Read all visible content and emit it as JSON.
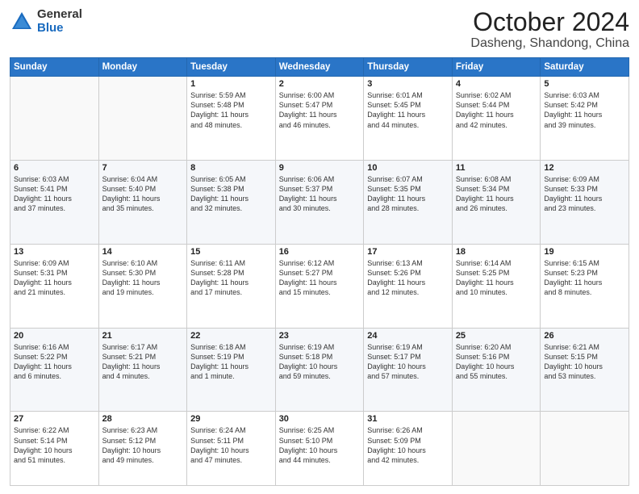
{
  "logo": {
    "general": "General",
    "blue": "Blue"
  },
  "header": {
    "month": "October 2024",
    "location": "Dasheng, Shandong, China"
  },
  "days_of_week": [
    "Sunday",
    "Monday",
    "Tuesday",
    "Wednesday",
    "Thursday",
    "Friday",
    "Saturday"
  ],
  "weeks": [
    [
      {
        "day": "",
        "info": ""
      },
      {
        "day": "",
        "info": ""
      },
      {
        "day": "1",
        "info": "Sunrise: 5:59 AM\nSunset: 5:48 PM\nDaylight: 11 hours\nand 48 minutes."
      },
      {
        "day": "2",
        "info": "Sunrise: 6:00 AM\nSunset: 5:47 PM\nDaylight: 11 hours\nand 46 minutes."
      },
      {
        "day": "3",
        "info": "Sunrise: 6:01 AM\nSunset: 5:45 PM\nDaylight: 11 hours\nand 44 minutes."
      },
      {
        "day": "4",
        "info": "Sunrise: 6:02 AM\nSunset: 5:44 PM\nDaylight: 11 hours\nand 42 minutes."
      },
      {
        "day": "5",
        "info": "Sunrise: 6:03 AM\nSunset: 5:42 PM\nDaylight: 11 hours\nand 39 minutes."
      }
    ],
    [
      {
        "day": "6",
        "info": "Sunrise: 6:03 AM\nSunset: 5:41 PM\nDaylight: 11 hours\nand 37 minutes."
      },
      {
        "day": "7",
        "info": "Sunrise: 6:04 AM\nSunset: 5:40 PM\nDaylight: 11 hours\nand 35 minutes."
      },
      {
        "day": "8",
        "info": "Sunrise: 6:05 AM\nSunset: 5:38 PM\nDaylight: 11 hours\nand 32 minutes."
      },
      {
        "day": "9",
        "info": "Sunrise: 6:06 AM\nSunset: 5:37 PM\nDaylight: 11 hours\nand 30 minutes."
      },
      {
        "day": "10",
        "info": "Sunrise: 6:07 AM\nSunset: 5:35 PM\nDaylight: 11 hours\nand 28 minutes."
      },
      {
        "day": "11",
        "info": "Sunrise: 6:08 AM\nSunset: 5:34 PM\nDaylight: 11 hours\nand 26 minutes."
      },
      {
        "day": "12",
        "info": "Sunrise: 6:09 AM\nSunset: 5:33 PM\nDaylight: 11 hours\nand 23 minutes."
      }
    ],
    [
      {
        "day": "13",
        "info": "Sunrise: 6:09 AM\nSunset: 5:31 PM\nDaylight: 11 hours\nand 21 minutes."
      },
      {
        "day": "14",
        "info": "Sunrise: 6:10 AM\nSunset: 5:30 PM\nDaylight: 11 hours\nand 19 minutes."
      },
      {
        "day": "15",
        "info": "Sunrise: 6:11 AM\nSunset: 5:28 PM\nDaylight: 11 hours\nand 17 minutes."
      },
      {
        "day": "16",
        "info": "Sunrise: 6:12 AM\nSunset: 5:27 PM\nDaylight: 11 hours\nand 15 minutes."
      },
      {
        "day": "17",
        "info": "Sunrise: 6:13 AM\nSunset: 5:26 PM\nDaylight: 11 hours\nand 12 minutes."
      },
      {
        "day": "18",
        "info": "Sunrise: 6:14 AM\nSunset: 5:25 PM\nDaylight: 11 hours\nand 10 minutes."
      },
      {
        "day": "19",
        "info": "Sunrise: 6:15 AM\nSunset: 5:23 PM\nDaylight: 11 hours\nand 8 minutes."
      }
    ],
    [
      {
        "day": "20",
        "info": "Sunrise: 6:16 AM\nSunset: 5:22 PM\nDaylight: 11 hours\nand 6 minutes."
      },
      {
        "day": "21",
        "info": "Sunrise: 6:17 AM\nSunset: 5:21 PM\nDaylight: 11 hours\nand 4 minutes."
      },
      {
        "day": "22",
        "info": "Sunrise: 6:18 AM\nSunset: 5:19 PM\nDaylight: 11 hours\nand 1 minute."
      },
      {
        "day": "23",
        "info": "Sunrise: 6:19 AM\nSunset: 5:18 PM\nDaylight: 10 hours\nand 59 minutes."
      },
      {
        "day": "24",
        "info": "Sunrise: 6:19 AM\nSunset: 5:17 PM\nDaylight: 10 hours\nand 57 minutes."
      },
      {
        "day": "25",
        "info": "Sunrise: 6:20 AM\nSunset: 5:16 PM\nDaylight: 10 hours\nand 55 minutes."
      },
      {
        "day": "26",
        "info": "Sunrise: 6:21 AM\nSunset: 5:15 PM\nDaylight: 10 hours\nand 53 minutes."
      }
    ],
    [
      {
        "day": "27",
        "info": "Sunrise: 6:22 AM\nSunset: 5:14 PM\nDaylight: 10 hours\nand 51 minutes."
      },
      {
        "day": "28",
        "info": "Sunrise: 6:23 AM\nSunset: 5:12 PM\nDaylight: 10 hours\nand 49 minutes."
      },
      {
        "day": "29",
        "info": "Sunrise: 6:24 AM\nSunset: 5:11 PM\nDaylight: 10 hours\nand 47 minutes."
      },
      {
        "day": "30",
        "info": "Sunrise: 6:25 AM\nSunset: 5:10 PM\nDaylight: 10 hours\nand 44 minutes."
      },
      {
        "day": "31",
        "info": "Sunrise: 6:26 AM\nSunset: 5:09 PM\nDaylight: 10 hours\nand 42 minutes."
      },
      {
        "day": "",
        "info": ""
      },
      {
        "day": "",
        "info": ""
      }
    ]
  ]
}
